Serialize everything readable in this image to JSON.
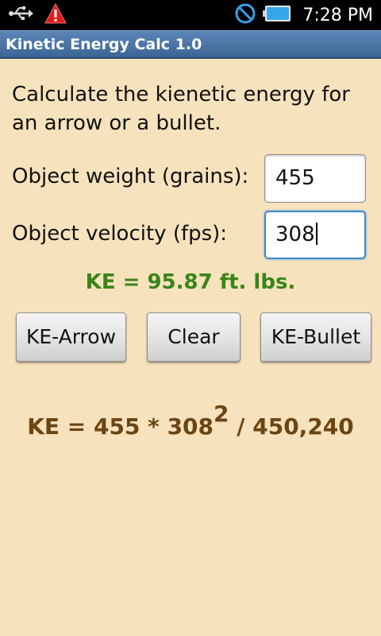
{
  "status_bar": {
    "icons_left": [
      "usb-icon",
      "warning-icon"
    ],
    "icons_right": [
      "no-signal-icon",
      "battery-icon"
    ],
    "time": "7:28 PM"
  },
  "app": {
    "title": "Kinetic Energy Calc 1.0"
  },
  "form": {
    "intro": "Calculate the kienetic energy for an arrow or a bullet.",
    "weight_label": "Object weight (grains):",
    "weight_value": "455",
    "velocity_label": "Object velocity (fps):",
    "velocity_value": "308"
  },
  "result": {
    "text": "KE = 95.87 ft. lbs."
  },
  "buttons": {
    "arrow": "KE-Arrow",
    "clear": "Clear",
    "bullet": "KE-Bullet"
  },
  "formula": {
    "prefix": "KE = 455 * 308",
    "exponent": "2",
    "suffix": " / 450,240"
  },
  "colors": {
    "background": "#f6e2bd",
    "title_bar": "#4a73a6",
    "result_green": "#3a8518",
    "formula_brown": "#6b4513",
    "focus_blue": "#3c88cc"
  }
}
